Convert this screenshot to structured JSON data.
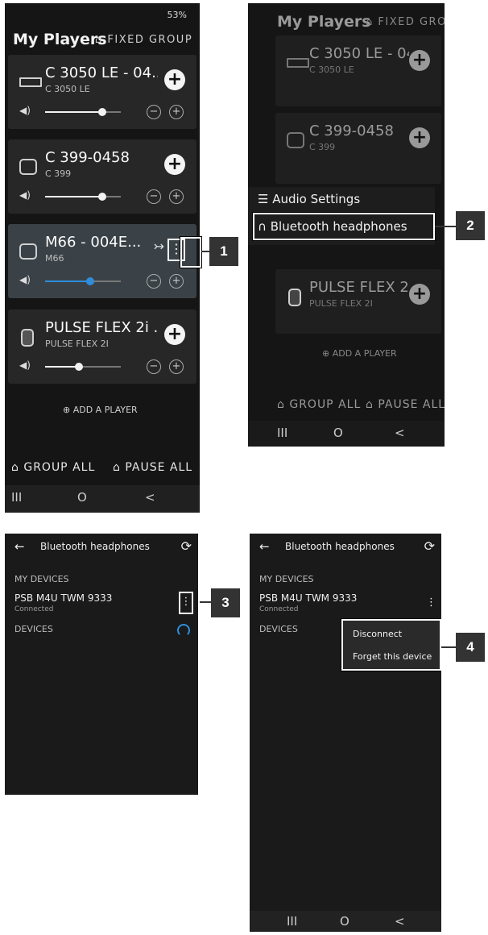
{
  "screen1": {
    "status_text": "53%",
    "title": "My Players",
    "fixed_group": "FIXED GROUP",
    "players": [
      {
        "name": "C 3050 LE - 04...",
        "model": "C 3050 LE",
        "volume": 0.75
      },
      {
        "name": "C 399-0458",
        "model": "C 399",
        "volume": 0.75
      },
      {
        "name": "M66 - 004E...",
        "model": "M66",
        "volume": 0.6
      },
      {
        "name": "PULSE FLEX 2i ...",
        "model": "PULSE FLEX 2I",
        "volume": 0.45
      }
    ],
    "add_player": "ADD A PLAYER",
    "group_all": "GROUP ALL",
    "pause_all": "PAUSE ALL"
  },
  "screen2": {
    "title": "My Players",
    "fixed_group": "FIXED GROUP",
    "menu_items": [
      "Audio Settings",
      "Bluetooth headphones"
    ],
    "add_player": "ADD A PLAYER",
    "group_all": "GROUP ALL",
    "pause_all": "PAUSE ALL"
  },
  "screen3": {
    "header_title": "Bluetooth headphones",
    "my_devices_label": "MY DEVICES",
    "device_name": "PSB M4U TWM 9333",
    "device_status": "Connected",
    "devices_label": "DEVICES"
  },
  "screen4": {
    "header_title": "Bluetooth headphones",
    "my_devices_label": "MY DEVICES",
    "device_name": "PSB M4U TWM 9333",
    "device_status": "Connected",
    "devices_label": "DEVICES",
    "menu_items": [
      "Disconnect",
      "Forget this device"
    ]
  },
  "callouts": [
    "1",
    "2",
    "3",
    "4"
  ],
  "nav": {
    "recents": "III",
    "home": "O",
    "back": "<"
  },
  "colors": {
    "accent": "#2f8ddb",
    "callout": "#333333"
  }
}
